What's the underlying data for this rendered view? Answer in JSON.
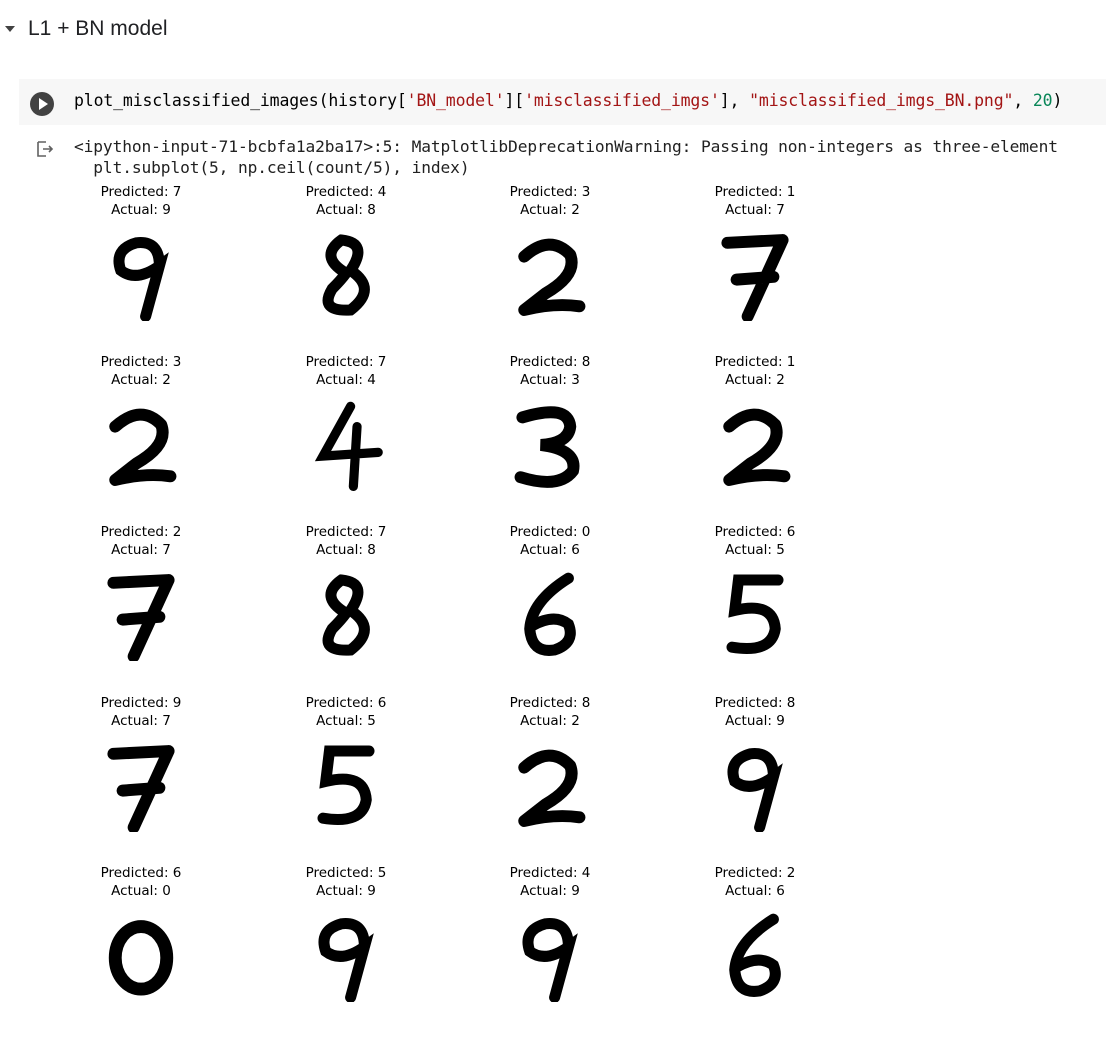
{
  "section": {
    "title": "L1 + BN model"
  },
  "cell": {
    "code": {
      "func": "plot_misclassified_images(history[",
      "s1": "'BN_model'",
      "m1": "][",
      "s2": "'misclassified_imgs'",
      "m2": "], ",
      "s3": "\"misclassified_imgs_BN.png\"",
      "m3": ", ",
      "n1": "20",
      "end": ")"
    }
  },
  "output": {
    "warning_line1": "<ipython-input-71-bcbfa1a2ba17>:5: MatplotlibDeprecationWarning: Passing non-integers as three-element",
    "warning_line2": "  plt.subplot(5, np.ceil(count/5), index)"
  },
  "icons": {
    "run": "play-circle-icon",
    "output": "output-arrow-icon",
    "section": "caret-down-icon"
  },
  "figure": {
    "images": [
      {
        "predicted": "Predicted: 7",
        "actual": "Actual: 9",
        "digit": "9"
      },
      {
        "predicted": "Predicted: 4",
        "actual": "Actual: 8",
        "digit": "8"
      },
      {
        "predicted": "Predicted: 3",
        "actual": "Actual: 2",
        "digit": "2"
      },
      {
        "predicted": "Predicted: 1",
        "actual": "Actual: 7",
        "digit": "7"
      },
      {
        "predicted": "Predicted: 3",
        "actual": "Actual: 2",
        "digit": "2"
      },
      {
        "predicted": "Predicted: 7",
        "actual": "Actual: 4",
        "digit": "4"
      },
      {
        "predicted": "Predicted: 8",
        "actual": "Actual: 3",
        "digit": "3"
      },
      {
        "predicted": "Predicted: 1",
        "actual": "Actual: 2",
        "digit": "2"
      },
      {
        "predicted": "Predicted: 2",
        "actual": "Actual: 7",
        "digit": "7"
      },
      {
        "predicted": "Predicted: 7",
        "actual": "Actual: 8",
        "digit": "8"
      },
      {
        "predicted": "Predicted: 0",
        "actual": "Actual: 6",
        "digit": "6"
      },
      {
        "predicted": "Predicted: 6",
        "actual": "Actual: 5",
        "digit": "5"
      },
      {
        "predicted": "Predicted: 9",
        "actual": "Actual: 7",
        "digit": "7"
      },
      {
        "predicted": "Predicted: 6",
        "actual": "Actual: 5",
        "digit": "5"
      },
      {
        "predicted": "Predicted: 8",
        "actual": "Actual: 2",
        "digit": "2"
      },
      {
        "predicted": "Predicted: 8",
        "actual": "Actual: 9",
        "digit": "9"
      },
      {
        "predicted": "Predicted: 6",
        "actual": "Actual: 0",
        "digit": "0"
      },
      {
        "predicted": "Predicted: 5",
        "actual": "Actual: 9",
        "digit": "9"
      },
      {
        "predicted": "Predicted: 4",
        "actual": "Actual: 9",
        "digit": "9"
      },
      {
        "predicted": "Predicted: 2",
        "actual": "Actual: 6",
        "digit": "6"
      }
    ]
  }
}
